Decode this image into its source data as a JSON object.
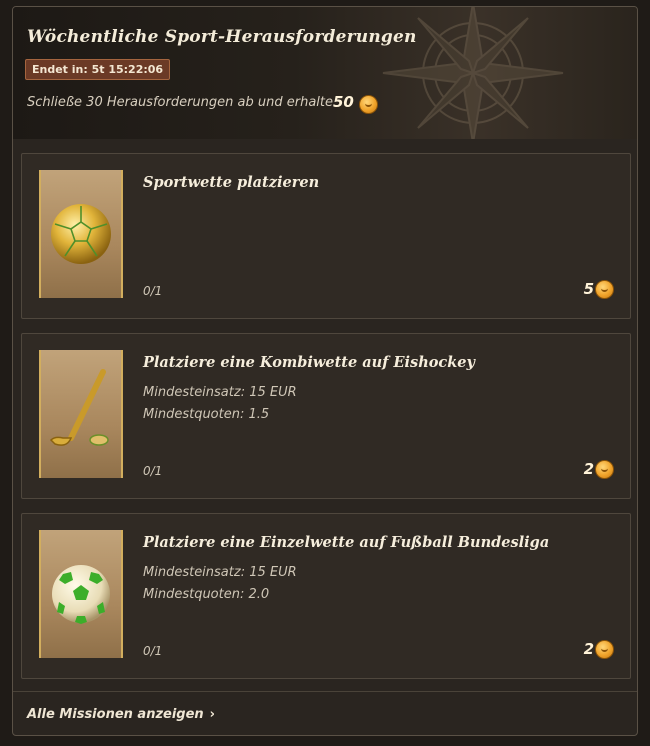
{
  "header": {
    "title": "Wöchentliche Sport-Herausforderungen",
    "timer": "Endet in: 5t 15:22:06",
    "description": "Schließe 30 Herausforderungen ab und erhalte",
    "reward": "50",
    "reward_icon": "coin-icon"
  },
  "challenges": [
    {
      "title": "Sportwette platzieren",
      "requirements": [],
      "progress": "0/1",
      "reward": "5",
      "image": "gold-soccer-ball-icon"
    },
    {
      "title": "Platziere eine Kombiwette auf Eishockey",
      "requirements": [
        "Mindesteinsatz: 15 EUR",
        "Mindestquoten: 1.5"
      ],
      "progress": "0/1",
      "reward": "2",
      "image": "hockey-stick-icon"
    },
    {
      "title": "Platziere eine Einzelwette auf Fußball Bundesliga",
      "requirements": [
        "Mindesteinsatz: 15 EUR",
        "Mindestquoten: 2.0"
      ],
      "progress": "0/1",
      "reward": "2",
      "image": "green-soccer-ball-icon"
    }
  ],
  "footer": {
    "link": "Alle Missionen anzeigen",
    "link_icon": "chevron-right-icon"
  },
  "colors": {
    "background": "#2a2520",
    "card": "#302a24",
    "timer_badge": "#6b3a26",
    "coin": "#f0a32a",
    "gold_border": "#d2ae5e"
  }
}
